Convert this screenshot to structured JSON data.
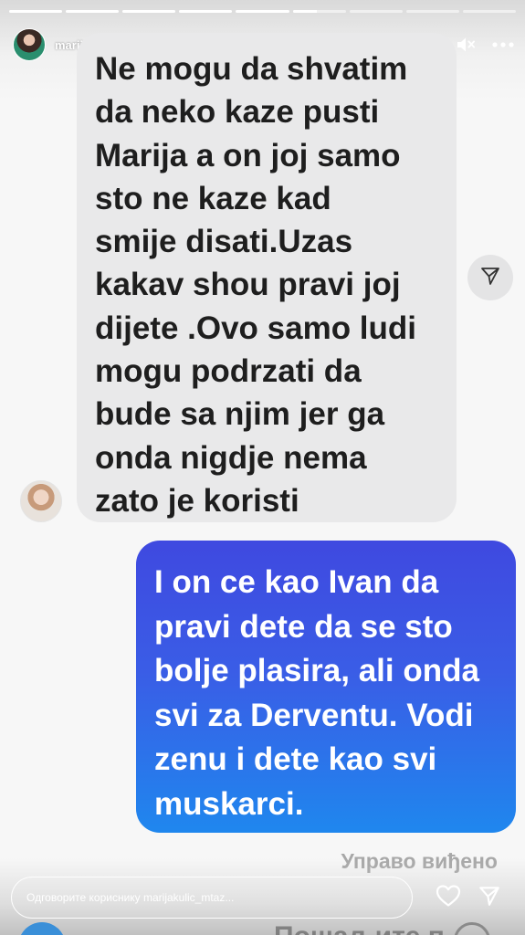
{
  "story": {
    "progress_segments": [
      1,
      1,
      1,
      1,
      1,
      0.45,
      0,
      0,
      0
    ],
    "username": "marijakulic_mtaz",
    "time": "9 ч",
    "icons": {
      "play": "play-icon",
      "mute": "mute-icon",
      "more": "more-icon"
    }
  },
  "received_message": {
    "text": "Ne mogu da shvatim\nda neko kaze pusti\nMarija a on joj samo\nsto ne kaze kad\nsmije disati.Uzas\nkakav shou pravi joj\ndijete .Ovo samo ludi\nmogu podrzati da\nbude sa njim jer ga\nonda nigdje nema\nzato je koristi"
  },
  "sent_message": {
    "text": "I on ce kao Ivan da\npravi dete da se sto\nbolje plasira, ali onda\nsvi za Derventu. Vodi\nzenu i dete kao svi\nmuskarci."
  },
  "seen_label": "Управо виђено",
  "reply": {
    "placeholder": "Одговорите кориснику marijakulic_mtaz..."
  },
  "underlay_text": "Пошаљите п",
  "colors": {
    "received_bubble": "#e9e9ea",
    "sent_gradient_top": "#3f49e0",
    "sent_gradient_bottom": "#1f87ee"
  }
}
